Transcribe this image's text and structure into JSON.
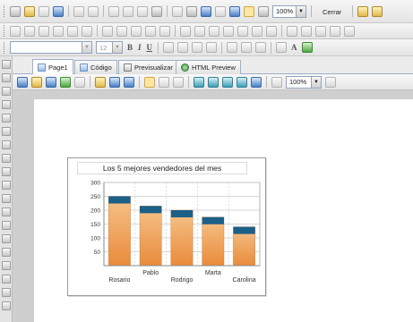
{
  "toolbar": {
    "zoom_top": "100%",
    "close_label": "Cerrar",
    "font_size": "12",
    "font_size_arrow": "▼",
    "bold": "B",
    "italic": "I",
    "underline": "U",
    "font_color": "A",
    "zoom_editor": "100%",
    "dropdown_arrow": "▼"
  },
  "tabs": [
    {
      "label": "Page1"
    },
    {
      "label": "Código"
    },
    {
      "label": "Previsualizar"
    },
    {
      "label": "HTML Preview"
    }
  ],
  "chart_data": {
    "type": "bar",
    "title": "Los 5 mejores vendedores del mes",
    "categories": [
      "Rosario",
      "Pablo",
      "Rodrigo",
      "Marta",
      "Carolina"
    ],
    "values": [
      250,
      215,
      200,
      175,
      140
    ],
    "ylim": [
      0,
      300
    ],
    "yticks": [
      50,
      100,
      150,
      200,
      250,
      300
    ],
    "grid": true,
    "xlabel": "",
    "ylabel": "",
    "colors": {
      "bar_top": "#1c5f87",
      "bar_body_light": "#f6c38a",
      "bar_body_dark": "#e98b3b",
      "grid": "#c9c9c9",
      "plot_bg": "#ffffff"
    }
  }
}
